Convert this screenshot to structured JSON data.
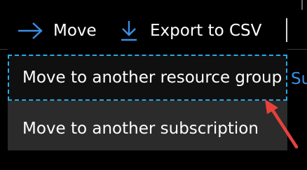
{
  "toolbar": {
    "move_label": "Move",
    "export_label": "Export to CSV"
  },
  "menu": {
    "items": [
      {
        "label": "Move to another resource group"
      },
      {
        "label": "Move to another subscription"
      }
    ]
  },
  "side_link": "Su",
  "colors": {
    "background": "#000000",
    "menu_background": "#2b2b2b",
    "focus_ring": "#2aa9e6",
    "accent": "#3a8fe6",
    "annotation_arrow": "#e8413c"
  },
  "icons": {
    "move": "arrow-right-icon",
    "export": "download-arrow-icon"
  }
}
